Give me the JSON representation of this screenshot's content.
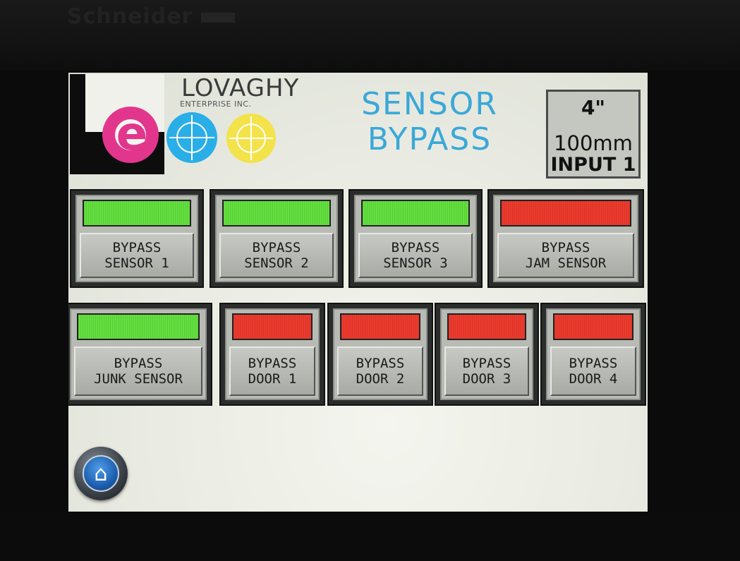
{
  "bezel": {
    "brand": "Schneider"
  },
  "logo": {
    "company": "LOVAGHY",
    "subtitle": "ENTERPRISE INC.",
    "letter": "e"
  },
  "title": {
    "line1": "SENSOR",
    "line2": "BYPASS"
  },
  "info": {
    "size": "4\"",
    "metric": "100mm",
    "input": "INPUT 1"
  },
  "row1": [
    {
      "line1": "BYPASS",
      "line2": "SENSOR 1",
      "status": "green"
    },
    {
      "line1": "BYPASS",
      "line2": "SENSOR 2",
      "status": "green"
    },
    {
      "line1": "BYPASS",
      "line2": "SENSOR 3",
      "status": "green"
    },
    {
      "line1": "BYPASS",
      "line2": "JAM SENSOR",
      "status": "red"
    }
  ],
  "row2": [
    {
      "line1": "BYPASS",
      "line2": "JUNK SENSOR",
      "status": "green"
    },
    {
      "line1": "BYPASS",
      "line2": "DOOR 1",
      "status": "red"
    },
    {
      "line1": "BYPASS",
      "line2": "DOOR 2",
      "status": "red"
    },
    {
      "line1": "BYPASS",
      "line2": "DOOR 3",
      "status": "red"
    },
    {
      "line1": "BYPASS",
      "line2": "DOOR 4",
      "status": "red"
    }
  ],
  "colors": {
    "green": "#62df3e",
    "red": "#ec3a2e",
    "title": "#3aa8d8",
    "pink": "#e2368d",
    "blue": "#2aaee8",
    "yellow": "#f3e24a"
  },
  "icons": {
    "home": "home-icon"
  }
}
